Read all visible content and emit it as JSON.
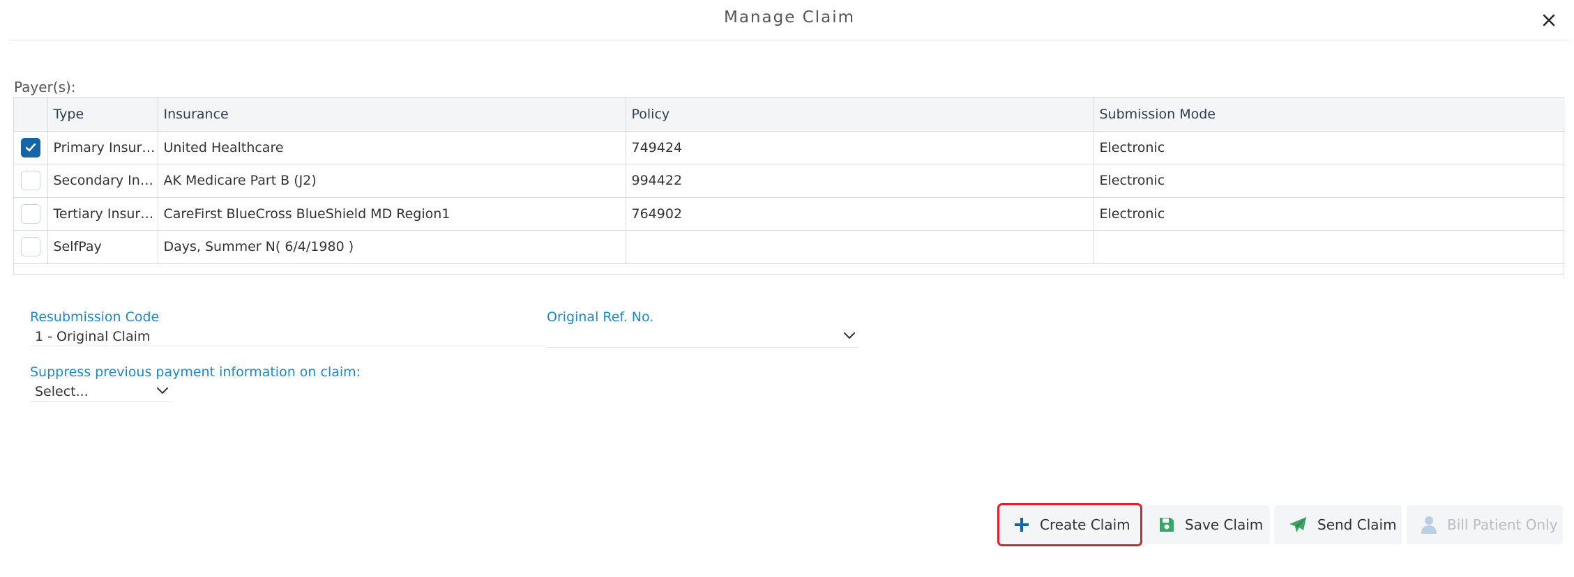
{
  "dialog": {
    "title": "Manage Claim"
  },
  "payers": {
    "label": "Payer(s):",
    "columns": [
      "Type",
      "Insurance",
      "Policy",
      "Submission Mode"
    ],
    "rows": [
      {
        "checked": true,
        "type": "Primary Insura...",
        "insurance": "United Healthcare",
        "policy": "749424",
        "mode": "Electronic"
      },
      {
        "checked": false,
        "type": "Secondary Ins...",
        "insurance": "AK Medicare Part B (J2)",
        "policy": "994422",
        "mode": "Electronic"
      },
      {
        "checked": false,
        "type": "Tertiary Insura...",
        "insurance": "CareFirst BlueCross BlueShield MD Region1",
        "policy": "764902",
        "mode": "Electronic"
      },
      {
        "checked": false,
        "type": "SelfPay",
        "insurance": "Days, Summer N( 6/4/1980 )",
        "policy": "",
        "mode": ""
      }
    ]
  },
  "form": {
    "resubmission_label": "Resubmission Code",
    "resubmission_value": "1 - Original Claim",
    "original_ref_label": "Original Ref. No.",
    "original_ref_value": "",
    "suppress_label": "Suppress previous payment information on claim:",
    "suppress_value": "Select..."
  },
  "actions": {
    "create": "Create Claim",
    "save": "Save Claim",
    "send": "Send Claim",
    "bill_patient": "Bill Patient Only"
  },
  "colors": {
    "accent_blue": "#1565a6",
    "label_blue": "#1e88c7",
    "save_green": "#3aa565",
    "highlight_red": "#e0202a"
  }
}
